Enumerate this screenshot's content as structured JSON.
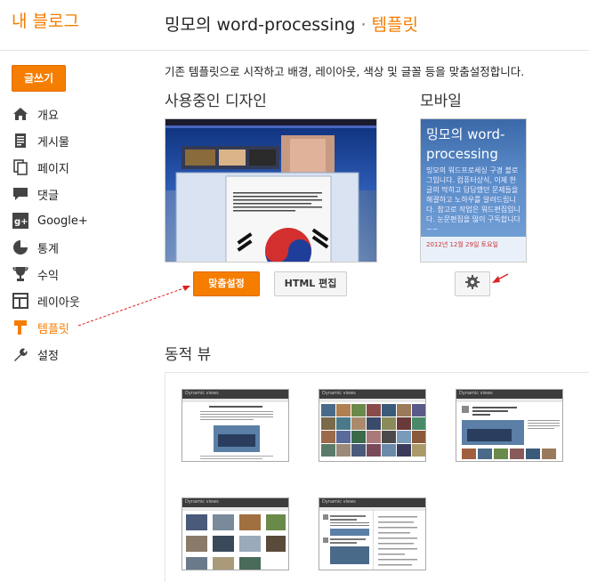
{
  "brand": "내 블로그",
  "header": {
    "blog_name": "밍모의 word-processing",
    "separator": "·",
    "section": "템플릿"
  },
  "sidebar": {
    "new_post": "글쓰기",
    "items": [
      {
        "label": "개요",
        "icon": "home-icon"
      },
      {
        "label": "게시물",
        "icon": "posts-icon"
      },
      {
        "label": "페이지",
        "icon": "pages-icon"
      },
      {
        "label": "댓글",
        "icon": "comments-icon"
      },
      {
        "label": "Google+",
        "icon": "google-plus-icon"
      },
      {
        "label": "통계",
        "icon": "stats-icon"
      },
      {
        "label": "수익",
        "icon": "earnings-icon"
      },
      {
        "label": "레이아웃",
        "icon": "layout-icon"
      },
      {
        "label": "템플릿",
        "icon": "template-icon",
        "active": true
      },
      {
        "label": "설정",
        "icon": "settings-icon"
      }
    ]
  },
  "main": {
    "description": "기존 템플릿으로 시작하고 배경, 레이아웃, 색상 및 글꼴 등을 맞춤설정합니다.",
    "current_design_heading": "사용중인 디자인",
    "mobile_heading": "모바일",
    "customize_button": "맞춤설정",
    "edit_html_button": "HTML 편집",
    "mobile_preview": {
      "title": "밍모의 word-processing",
      "text": "밍모의 워드프로세싱 구경 블로그입니다. 컴퓨터상식, 이제 한글의 막히고 답답했던 문제들을 해결하고 노하우를 알려드립니다. 참고로 작업은 워드편집입니다. 눈문편집을 많이 구독합니다~~",
      "date": "2012년 12월 29일 토요일"
    },
    "dynamic_heading": "동적 뷰",
    "dynamic_views_label": "Dynamic views"
  },
  "colors": {
    "accent": "#f57d00",
    "annotation": "#dd2222"
  }
}
